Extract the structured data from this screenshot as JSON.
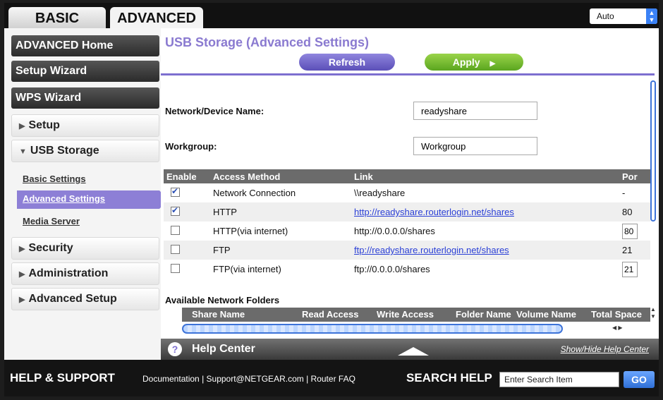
{
  "tabs": {
    "basic": "BASIC",
    "advanced": "ADVANCED"
  },
  "language_select": {
    "value": "Auto"
  },
  "sidebar": {
    "advanced_home": "ADVANCED Home",
    "setup_wizard": "Setup Wizard",
    "wps_wizard": "WPS Wizard",
    "setup": "Setup",
    "usb_storage": "USB Storage",
    "basic_settings": "Basic Settings",
    "advanced_settings": "Advanced Settings",
    "media_server": "Media Server",
    "security": "Security",
    "administration": "Administration",
    "advanced_setup": "Advanced Setup"
  },
  "main": {
    "title": "USB Storage (Advanced Settings)",
    "refresh": "Refresh",
    "apply": "Apply",
    "network_device_name_label": "Network/Device Name:",
    "network_device_name_value": "readyshare",
    "workgroup_label": "Workgroup:",
    "workgroup_value": "Workgroup",
    "table": {
      "headers": [
        "Enable",
        "Access Method",
        "Link",
        "Por"
      ],
      "rows": [
        {
          "enabled": true,
          "method": "Network Connection",
          "link": "\\\\readyshare",
          "port": "-"
        },
        {
          "enabled": true,
          "method": "HTTP",
          "link": "http://readyshare.routerlogin.net/shares",
          "port": "80"
        },
        {
          "enabled": false,
          "method": "HTTP(via internet)",
          "link": "http://0.0.0.0/shares",
          "port": "80"
        },
        {
          "enabled": false,
          "method": "FTP",
          "link": "ftp://readyshare.routerlogin.net/shares",
          "port": "21"
        },
        {
          "enabled": false,
          "method": "FTP(via internet)",
          "link": "ftp://0.0.0.0/shares",
          "port": "21"
        }
      ]
    },
    "folders": {
      "title": "Available Network Folders",
      "headers": [
        "Share Name",
        "Read Access",
        "Write Access",
        "Folder Name",
        "Volume Name",
        "Total Space"
      ]
    }
  },
  "help": {
    "title": "Help Center",
    "toggle": "Show/Hide Help Center"
  },
  "footer": {
    "title": "HELP & SUPPORT",
    "documentation": "Documentation",
    "support_email": "Support@NETGEAR.com",
    "router_faq": "Router FAQ",
    "search_label": "SEARCH HELP",
    "search_placeholder": "Enter Search Item",
    "go": "GO"
  }
}
